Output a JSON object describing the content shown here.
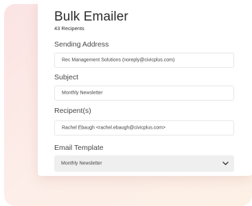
{
  "header": {
    "title": "Bulk Emailer",
    "recipients_count": "43 Recipents"
  },
  "form": {
    "sending_address": {
      "label": "Sending Address",
      "value": "Rec Management Solutions (noreply@civicplus.com)"
    },
    "subject": {
      "label": "Subject",
      "value": "Monthly Newsletter"
    },
    "recipients": {
      "label": "Recipent(s)",
      "value": "Rachel Ebaugh <rachel.ebaugh@civicplus.com>"
    },
    "email_template": {
      "label": "Email Template",
      "selected": "Monthly Newsletter"
    }
  },
  "icons": {
    "select_arrow": "chevron-down-icon"
  }
}
